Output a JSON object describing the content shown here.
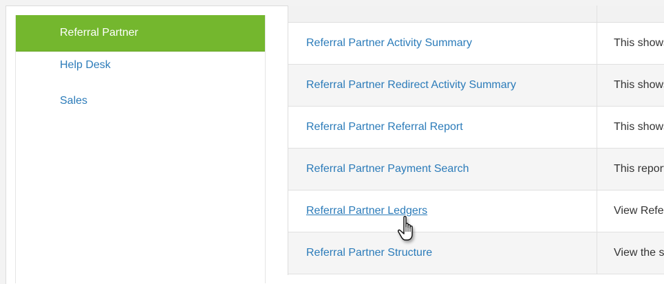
{
  "nav": {
    "items": [
      {
        "label": "Referral Partner",
        "active": true
      },
      {
        "label": "Help Desk",
        "active": false
      },
      {
        "label": "Sales",
        "active": false
      }
    ]
  },
  "reports": {
    "rows": [
      {
        "name": "Referral Partner Activity Summary",
        "desc": "This shows"
      },
      {
        "name": "Referral Partner Redirect Activity Summary",
        "desc": "This shows"
      },
      {
        "name": "Referral Partner Referral Report",
        "desc": "This shows"
      },
      {
        "name": "Referral Partner Payment Search",
        "desc": "This report"
      },
      {
        "name": "Referral Partner Ledgers",
        "desc": "View Referr"
      },
      {
        "name": "Referral Partner Structure",
        "desc": "View the st"
      }
    ]
  },
  "cursor": {
    "icon": "hand-pointer-icon"
  },
  "colors": {
    "accent": "#74b72e",
    "link": "#2b7bb9"
  }
}
